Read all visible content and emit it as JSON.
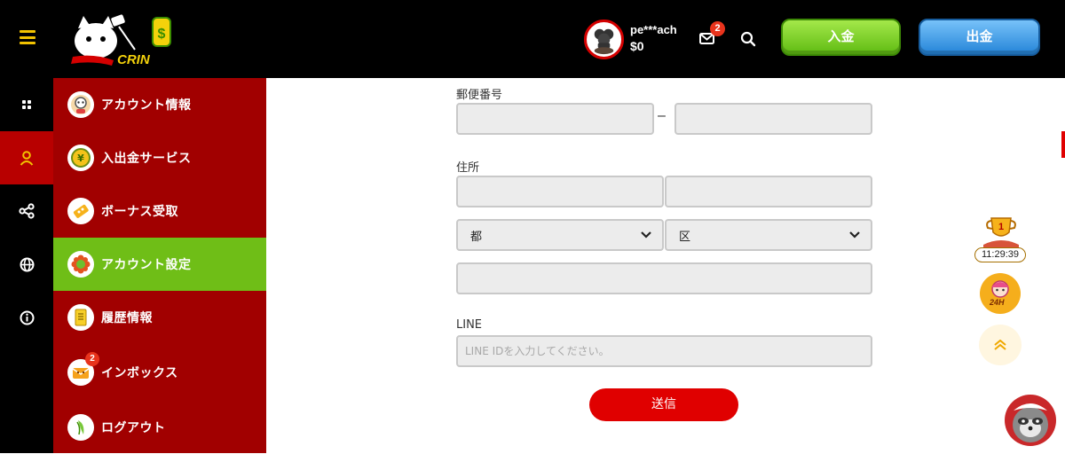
{
  "header": {
    "username": "pe***ach",
    "balance": "$0",
    "mail_count": "2",
    "deposit_label": "入金",
    "withdraw_label": "出金",
    "logo_text": "CRIN"
  },
  "rail": {
    "icons": [
      "grid-icon",
      "user-icon",
      "share-icon",
      "globe-icon",
      "info-icon"
    ],
    "active_index": 1
  },
  "menu": {
    "items": [
      {
        "label": "アカウント情報",
        "icon": "profile-avatar-icon"
      },
      {
        "label": "入出金サービス",
        "icon": "yen-coin-icon"
      },
      {
        "label": "ボーナス受取",
        "icon": "ticket-icon"
      },
      {
        "label": "アカウント設定",
        "icon": "gear-flower-icon"
      },
      {
        "label": "履歴情報",
        "icon": "document-icon"
      },
      {
        "label": "インボックス",
        "icon": "inbox-icon",
        "badge": "2"
      },
      {
        "label": "ログアウト",
        "icon": "logout-icon"
      }
    ],
    "active_index": 3
  },
  "form": {
    "postal_label": "郵便番号",
    "postal_separator": "–",
    "address_label": "住所",
    "prefecture_value": "都",
    "ward_value": "区",
    "line_label": "LINE",
    "line_placeholder": "LINE IDを入力してください。",
    "submit_label": "送信"
  },
  "widgets": {
    "timer": "11:29:39",
    "support_text": "24H"
  },
  "colors": {
    "header_bg": "#000000",
    "menu_bg": "#a10000",
    "menu_active_bg": "#6fbe17",
    "deposit_green": "#6fc21a",
    "withdraw_blue": "#2f8fe0",
    "submit_red": "#e00000"
  }
}
